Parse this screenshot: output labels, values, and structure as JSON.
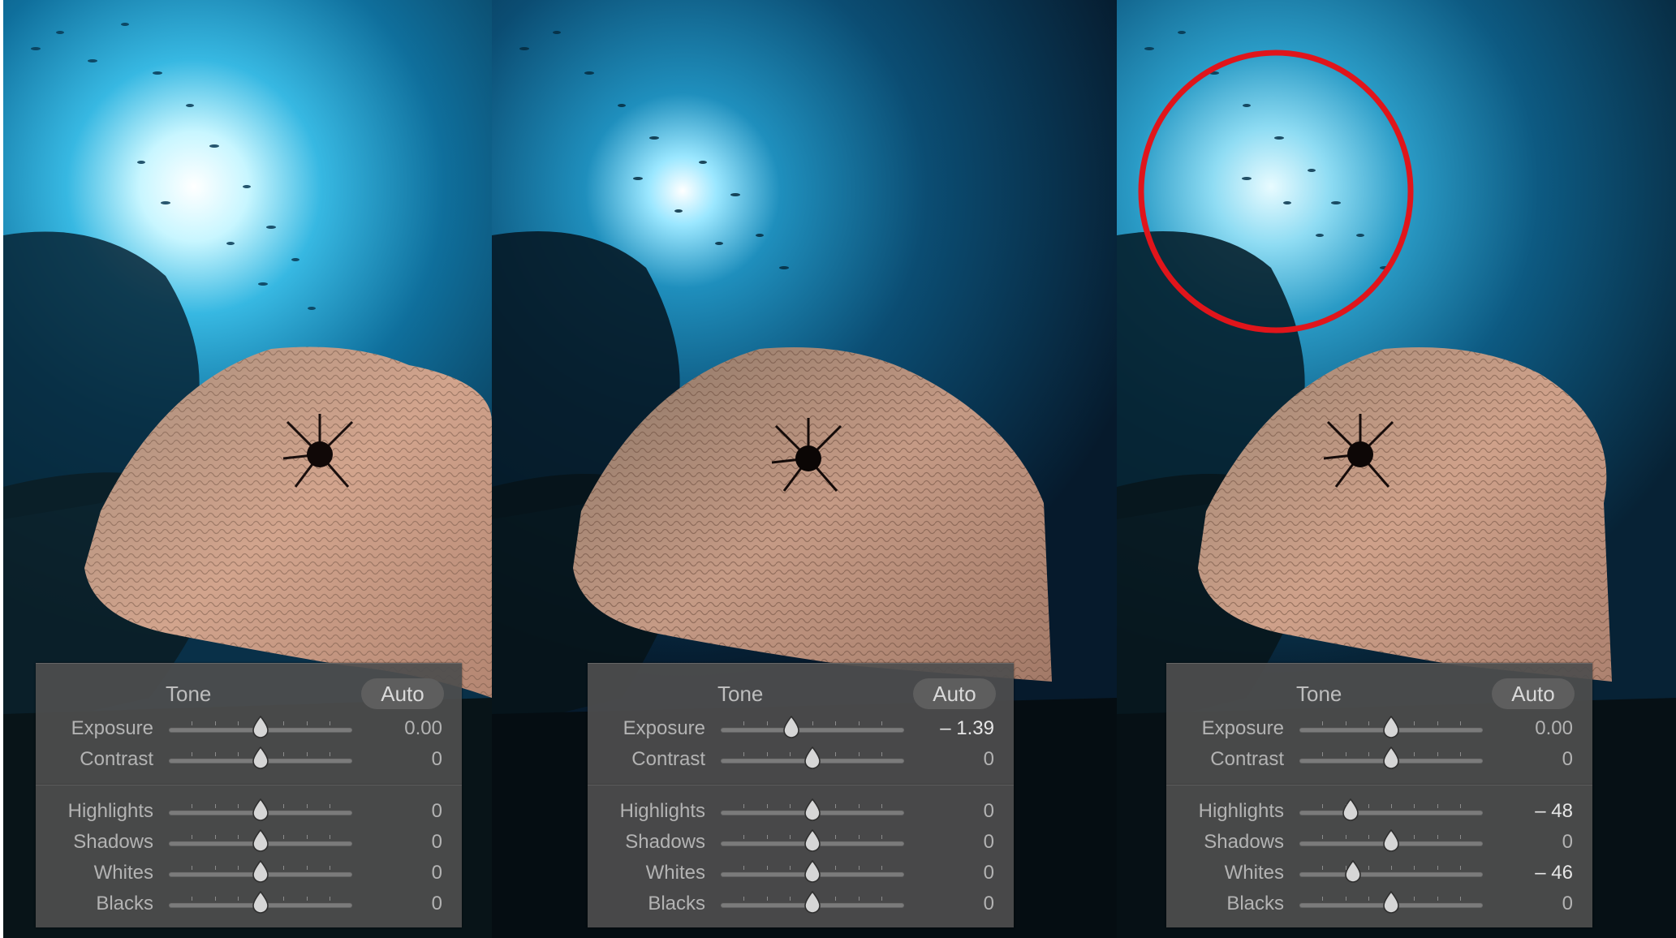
{
  "panels": [
    {
      "title": "Tone",
      "auto_label": "Auto",
      "sliders": [
        {
          "label": "Exposure",
          "value": "0.00",
          "position": 0.5
        },
        {
          "label": "Contrast",
          "value": "0",
          "position": 0.5
        },
        {
          "label": "Highlights",
          "value": "0",
          "position": 0.5
        },
        {
          "label": "Shadows",
          "value": "0",
          "position": 0.5
        },
        {
          "label": "Whites",
          "value": "0",
          "position": 0.5
        },
        {
          "label": "Blacks",
          "value": "0",
          "position": 0.5
        }
      ]
    },
    {
      "title": "Tone",
      "auto_label": "Auto",
      "sliders": [
        {
          "label": "Exposure",
          "value": "– 1.39",
          "position": 0.385
        },
        {
          "label": "Contrast",
          "value": "0",
          "position": 0.5
        },
        {
          "label": "Highlights",
          "value": "0",
          "position": 0.5
        },
        {
          "label": "Shadows",
          "value": "0",
          "position": 0.5
        },
        {
          "label": "Whites",
          "value": "0",
          "position": 0.5
        },
        {
          "label": "Blacks",
          "value": "0",
          "position": 0.5
        }
      ]
    },
    {
      "title": "Tone",
      "auto_label": "Auto",
      "sliders": [
        {
          "label": "Exposure",
          "value": "0.00",
          "position": 0.5
        },
        {
          "label": "Contrast",
          "value": "0",
          "position": 0.5
        },
        {
          "label": "Highlights",
          "value": "– 48",
          "position": 0.28
        },
        {
          "label": "Shadows",
          "value": "0",
          "position": 0.5
        },
        {
          "label": "Whites",
          "value": "– 46",
          "position": 0.29
        },
        {
          "label": "Blacks",
          "value": "0",
          "position": 0.5
        }
      ]
    }
  ],
  "colors": {
    "panel_bg": "#4e4e4e",
    "highlight_circle": "#e0151b",
    "water_light": "#bff4ff",
    "water_dark": "#06182b",
    "sea_fan": "#c99882"
  }
}
